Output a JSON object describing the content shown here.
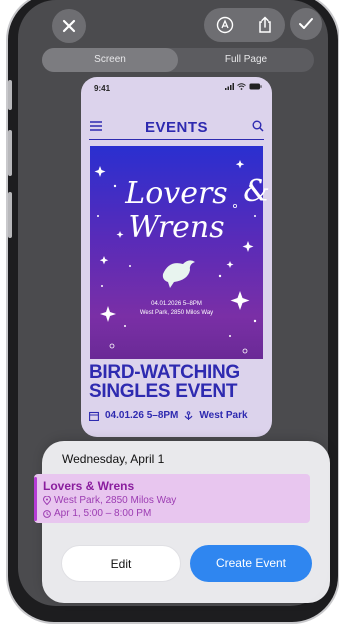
{
  "toolbar": {
    "close_icon": "close-icon",
    "markup_icon": "markup-pen-icon",
    "share_icon": "share-icon",
    "done_icon": "checkmark-icon"
  },
  "segments": {
    "screen_label": "Screen",
    "full_page_label": "Full Page",
    "selected": "Screen"
  },
  "preview": {
    "status_time": "9:41",
    "nav_title": "EVENTS",
    "poster": {
      "title_line1": "Lovers",
      "title_amp": "&",
      "title_line2": "Wrens",
      "date_time": "04.01.2026 5–8PM",
      "address": "West Park, 2850 Milos Way"
    },
    "event_heading_line1": "BIRD-WATCHING",
    "event_heading_line2": "SINGLES EVENT",
    "meta_date": "04.01.26 5–8PM",
    "meta_location": "West Park"
  },
  "sheet": {
    "date_header": "Wednesday, April 1",
    "event": {
      "title": "Lovers & Wrens",
      "location": "West Park, 2850 Milos Way",
      "time": "Apr 1, 5:00 – 8:00 PM"
    },
    "edit_label": "Edit",
    "create_label": "Create Event"
  },
  "colors": {
    "accent_blue": "#2f86f0",
    "event_purple": "#b63bd6",
    "events_brand": "#2e2ab0"
  }
}
